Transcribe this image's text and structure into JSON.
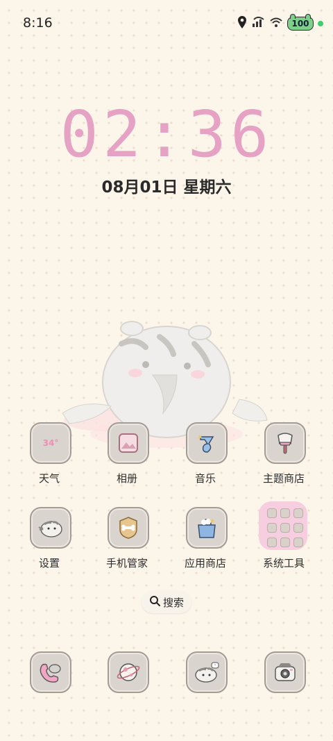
{
  "status_bar": {
    "time": "8:16",
    "battery": "100",
    "icons": [
      "location-icon",
      "signal-icon",
      "wifi-icon",
      "battery-icon",
      "active-dot-icon"
    ]
  },
  "lock": {
    "clock": "02:36",
    "date": "08月01日 星期六"
  },
  "apps": {
    "row1": [
      {
        "label": "天气",
        "icon": "weather-icon",
        "detail": "34°"
      },
      {
        "label": "相册",
        "icon": "gallery-icon"
      },
      {
        "label": "音乐",
        "icon": "music-icon"
      },
      {
        "label": "主题商店",
        "icon": "theme-store-icon"
      }
    ],
    "row2": [
      {
        "label": "设置",
        "icon": "settings-icon"
      },
      {
        "label": "手机管家",
        "icon": "phone-manager-icon"
      },
      {
        "label": "应用商店",
        "icon": "app-store-icon"
      },
      {
        "label": "系统工具",
        "icon": "folder-icon"
      }
    ]
  },
  "search": {
    "label": "搜索"
  },
  "dock": [
    {
      "icon": "phone-icon"
    },
    {
      "icon": "browser-icon"
    },
    {
      "icon": "messages-icon"
    },
    {
      "icon": "camera-icon"
    }
  ],
  "colors": {
    "background": "#fcf6ea",
    "clock": "#e5a2c4",
    "folder": "#f7cde0",
    "icon_bg": "#d9d4cd"
  }
}
